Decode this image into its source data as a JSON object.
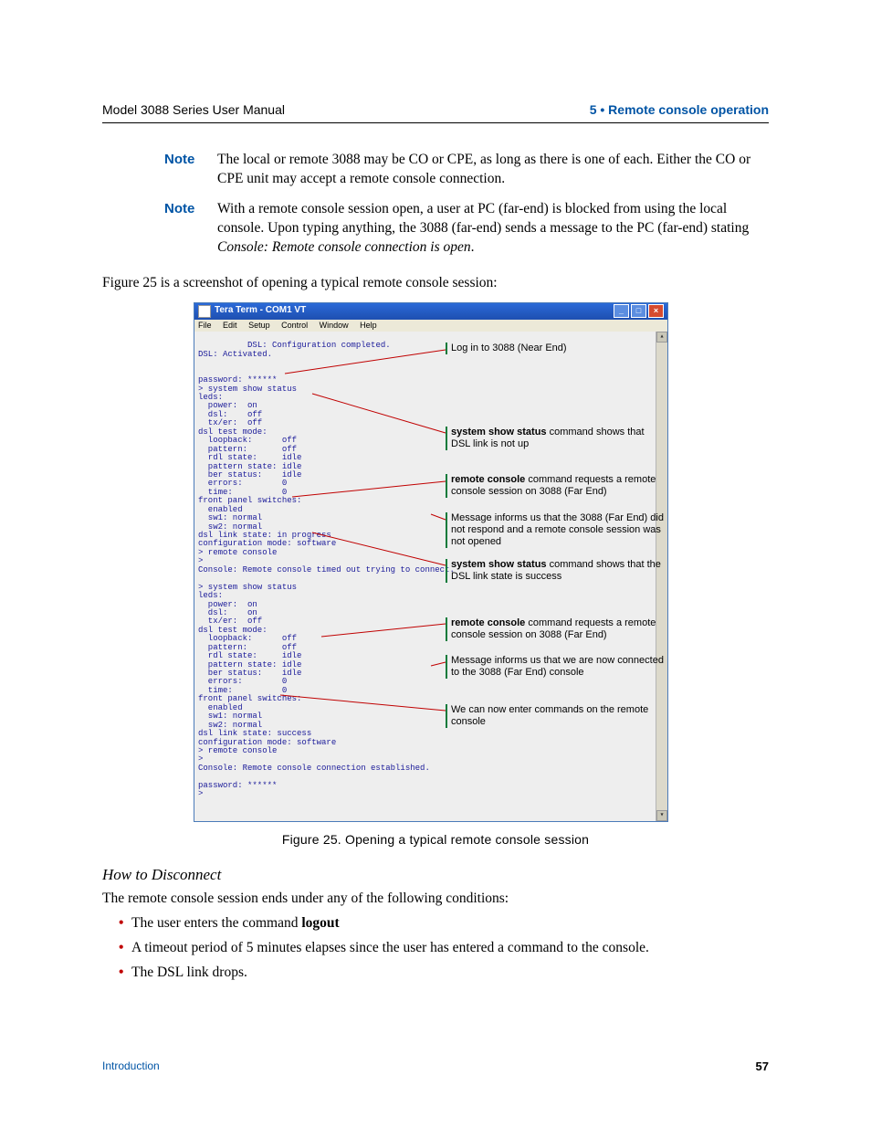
{
  "header": {
    "manual": "Model 3088 Series User Manual",
    "chapter": "5 • Remote console operation"
  },
  "notes": {
    "label": "Note",
    "n1": "The local or remote 3088 may be CO or CPE, as long as there is one of each. Either the CO or CPE unit may accept a remote console connection.",
    "n2a": "With a remote console session open, a user at PC (far-end) is blocked from using the local console. Upon typing anything, the 3088 (far-end) sends a message to the PC (far-end) stating ",
    "n2b": "Console: Remote console connection is open",
    "n2c": "."
  },
  "intro": "Figure 25 is a screenshot of opening a typical remote console session:",
  "window": {
    "title": "Tera Term - COM1 VT",
    "menu": [
      "File",
      "Edit",
      "Setup",
      "Control",
      "Window",
      "Help"
    ]
  },
  "term": "DSL: Configuration completed.\nDSL: Activated.\n\n\npassword: ******\n> system show status\nleds:\n  power:  on\n  dsl:    off\n  tx/er:  off\ndsl test mode:\n  loopback:      off\n  pattern:       off\n  rdl state:     idle\n  pattern state: idle\n  ber status:    idle\n  errors:        0\n  time:          0\nfront panel switches:\n  enabled\n  sw1: normal\n  sw2: normal\ndsl link state: in progress\nconfiguration mode: software\n> remote console\n>\nConsole: Remote console timed out trying to connect.\n\n> system show status\nleds:\n  power:  on\n  dsl:    on\n  tx/er:  off\ndsl test mode:\n  loopback:      off\n  pattern:       off\n  rdl state:     idle\n  pattern state: idle\n  ber status:    idle\n  errors:        0\n  time:          0\nfront panel switches:\n  enabled\n  sw1: normal\n  sw2: normal\ndsl link state: success\nconfiguration mode: software\n> remote console\n>\nConsole: Remote console connection established.\n\npassword: ******\n>",
  "callouts": {
    "c1": "Log in to 3088 (Near End)",
    "c2b": "system show status",
    "c2a": " command shows that DSL link is not up",
    "c3b": "remote console",
    "c3a": " command requests a remote console session on 3088 (Far End)",
    "c4": "Message informs us that the 3088 (Far End) did not respond and a remote console session was not opened",
    "c5b": "system show status",
    "c5a": " command shows that the DSL link state is success",
    "c6b": "remote console",
    "c6a": " command requests a remote console session on 3088 (Far End)",
    "c7": "Message informs us that we are now connected to the 3088 (Far End) console",
    "c8": "We can now enter commands on the remote console"
  },
  "figcaption": "Figure 25. Opening a typical remote console session",
  "howto": {
    "title": "How to Disconnect",
    "lead": "The remote console session ends under any of the following conditions:",
    "li1a": "The user enters the command ",
    "li1b": "logout",
    "li2": "A timeout period of 5 minutes elapses since the user has entered a command to the console.",
    "li3": "The DSL link drops."
  },
  "footer": {
    "section": "Introduction",
    "page": "57"
  }
}
